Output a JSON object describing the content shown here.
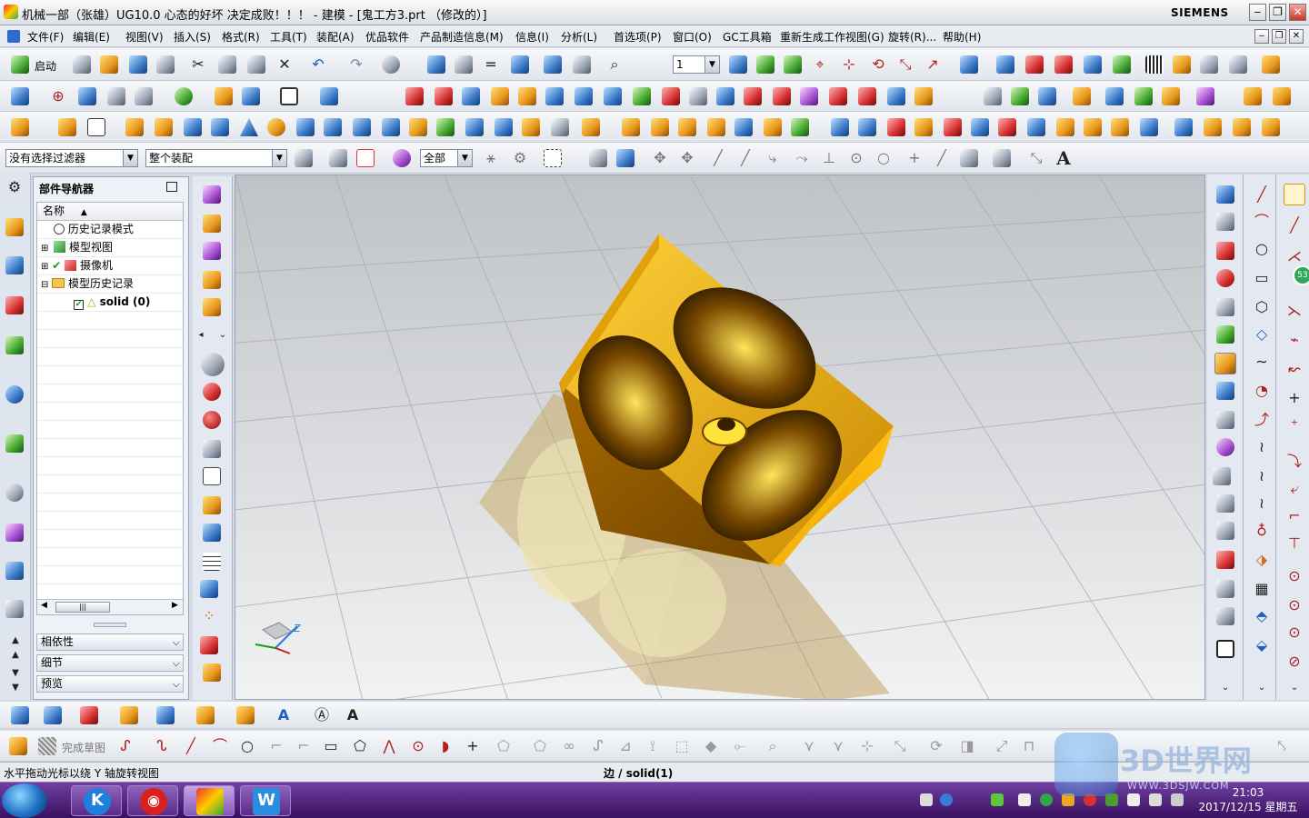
{
  "window": {
    "title": "机械一部（张雄）UG10.0 心态的好坏  决定成败！！！ - 建模 - [鬼工方3.prt （修改的）]",
    "brand": "SIEMENS",
    "min": "‒",
    "max": "❐",
    "close": "✕"
  },
  "menu": [
    "文件(F)",
    "编辑(E)",
    "视图(V)",
    "插入(S)",
    "格式(R)",
    "工具(T)",
    "装配(A)",
    "优品软件",
    "产品制造信息(M)",
    "信息(I)",
    "分析(L)",
    "首选项(P)",
    "窗口(O)",
    "GC工具箱",
    "重新生成工作视图(G)",
    "旋转(R)...",
    "帮助(H)"
  ],
  "toolbar": {
    "start_label": "启动",
    "layer_value": "1",
    "filter_value": "没有选择过滤器",
    "scope_value": "整个装配",
    "all_value": "全部",
    "text_tool": "A"
  },
  "navigator": {
    "title": "部件导航器",
    "column": "名称",
    "items": [
      {
        "label": "历史记录模式",
        "icon": "clock-icon"
      },
      {
        "label": "模型视图",
        "icon": "model-views-icon"
      },
      {
        "label": "摄像机",
        "icon": "camera-icon"
      },
      {
        "label": "模型历史记录",
        "icon": "folder-icon"
      },
      {
        "label": "solid (0)",
        "icon": "sketch-icon"
      }
    ],
    "sections": [
      "相依性",
      "细节",
      "预览"
    ]
  },
  "viewport": {
    "triad_z": "Z",
    "badge": "53"
  },
  "sketch_toolbar": {
    "finish_label": "完成草图"
  },
  "status": {
    "left": "水平拖动光标以绕 Y 轴旋转视图",
    "center": "边 / solid(1)"
  },
  "taskbar": {
    "time": "21:03",
    "date": "2017/12/15 星期五",
    "watermark": "3D世界网",
    "watermark_url": "WWW.3DSJW.COM"
  },
  "colors": {
    "model": "#f0b400",
    "titlebar": "#e8ebf0",
    "taskbar": "#4b1d78"
  }
}
